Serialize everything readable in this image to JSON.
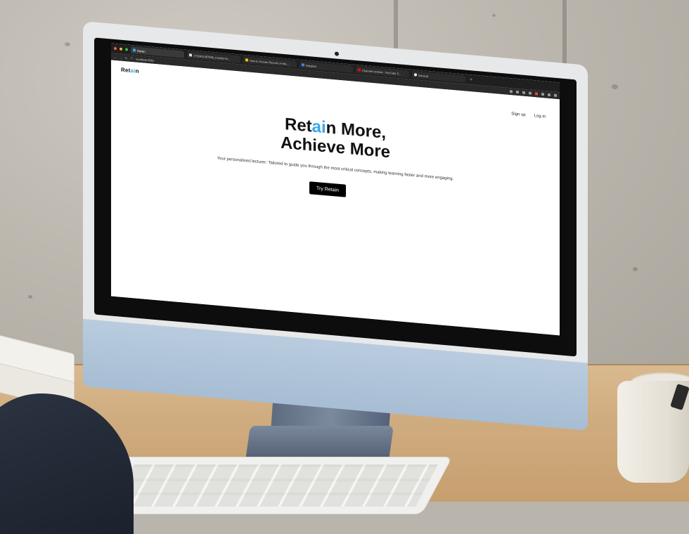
{
  "colors": {
    "accent": "#3aa7e8",
    "chin": "#b9ccdf",
    "page_background": "#ffffff",
    "button_background": "#000000"
  },
  "browser": {
    "tabs": [
      {
        "label": "Retain",
        "active": true
      },
      {
        "label": "1720451367698_transformi...",
        "active": false
      },
      {
        "label": "How to Screen Record on Ma...",
        "active": false
      },
      {
        "label": "Dimpled",
        "active": false
      },
      {
        "label": "Channel content - YouTube S...",
        "active": false
      },
      {
        "label": "General",
        "active": false
      }
    ],
    "url": "localhost:3001"
  },
  "app": {
    "logo": {
      "pre": "Ret",
      "accent": "ai",
      "post": "n"
    },
    "nav": {
      "signup": "Sign up",
      "login": "Log in"
    },
    "hero": {
      "line1_pre": "Ret",
      "line1_accent": "ai",
      "line1_post": "n More,",
      "line2": "Achieve More"
    },
    "subtitle": "Your personalized lecturer: Tailored to guide you through the most critical concepts, making learning faster and more engaging.",
    "cta": "Try Retain"
  }
}
